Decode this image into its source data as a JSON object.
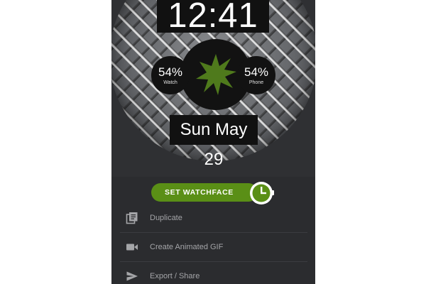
{
  "watchface": {
    "time": "12:41",
    "date": "Sun May 29",
    "watch_battery": {
      "percent": "54%",
      "label": "Watch"
    },
    "phone_battery": {
      "percent": "54%",
      "label": "Phone"
    },
    "accent_color": "#4f7a1c",
    "background": "diamond-plate-metal"
  },
  "actions": {
    "set_watchface_label": "SET WATCHFACE",
    "button_color": "#5a8f16"
  },
  "menu": {
    "items": [
      {
        "label": "Duplicate",
        "icon": "duplicate-icon"
      },
      {
        "label": "Create Animated GIF",
        "icon": "video-camera-icon"
      },
      {
        "label": "Export / Share",
        "icon": "send-icon"
      }
    ]
  }
}
